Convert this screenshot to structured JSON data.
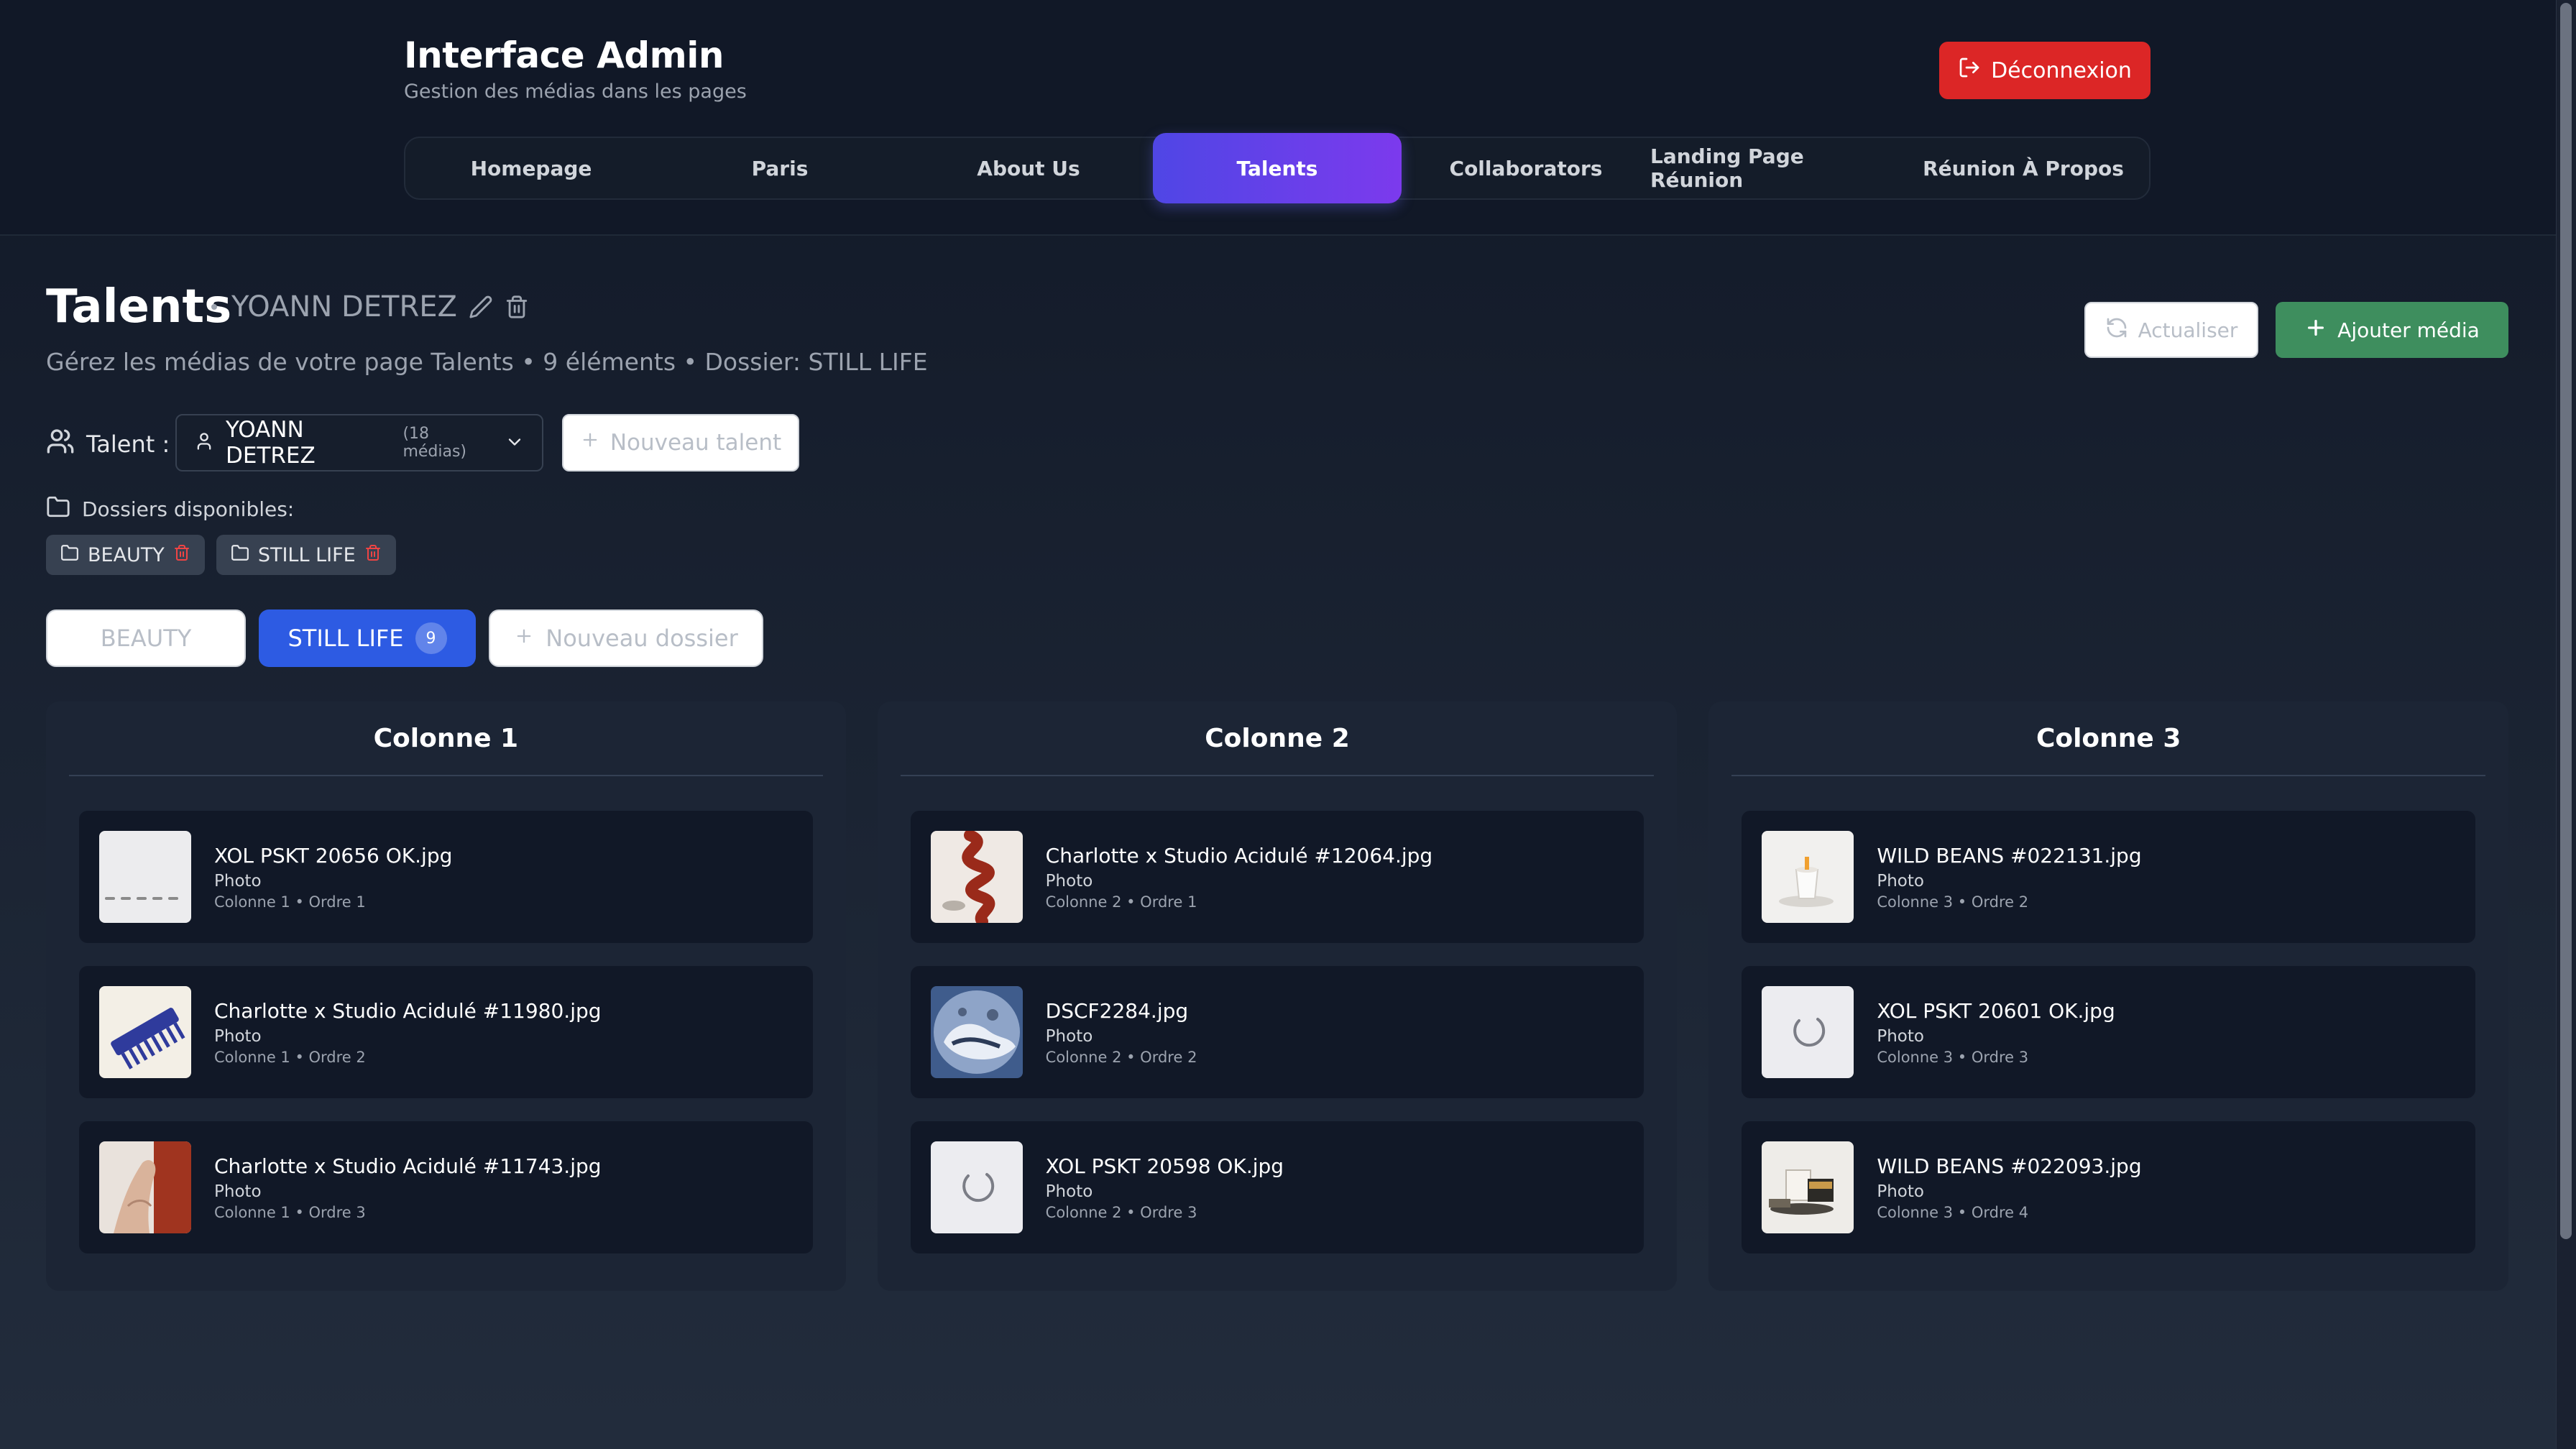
{
  "header": {
    "title": "Interface Admin",
    "subtitle": "Gestion des médias dans les pages",
    "logout_label": "Déconnexion",
    "nav": [
      "Homepage",
      "Paris",
      "About Us",
      "Talents",
      "Collaborators",
      "Landing Page Réunion",
      "Réunion À Propos"
    ],
    "active_nav": "Talents"
  },
  "page": {
    "title": "Talents",
    "talent_name": "YOANN DETREZ",
    "description": "Gérez les médias de votre page Talents • 9 éléments • Dossier: STILL LIFE",
    "refresh_label": "Actualiser",
    "add_label": "Ajouter média"
  },
  "talent_selector": {
    "label": "Talent :",
    "selected_name": "YOANN DETREZ",
    "selected_count": "(18 médias)",
    "new_talent_label": "Nouveau talent"
  },
  "folders": {
    "label": "Dossiers disponibles:",
    "chips": [
      "BEAUTY",
      "STILL LIFE"
    ],
    "tabs": [
      {
        "label": "BEAUTY",
        "active": false
      },
      {
        "label": "STILL LIFE",
        "active": true,
        "count": "9"
      }
    ],
    "new_folder_label": "Nouveau dossier"
  },
  "columns": [
    {
      "title": "Colonne 1",
      "items": [
        {
          "name": "XOL PSKT 20656 OK.jpg",
          "type": "Photo",
          "position": "Colonne 1 • Ordre 1",
          "thumb": "jewelry-row"
        },
        {
          "name": "Charlotte x Studio Acidulé #11980.jpg",
          "type": "Photo",
          "position": "Colonne 1 • Ordre 2",
          "thumb": "blue-comb"
        },
        {
          "name": "Charlotte x Studio Acidulé #11743.jpg",
          "type": "Photo",
          "position": "Colonne 1 • Ordre 3",
          "thumb": "hand-red"
        }
      ]
    },
    {
      "title": "Colonne 2",
      "items": [
        {
          "name": "Charlotte x Studio Acidulé #12064.jpg",
          "type": "Photo",
          "position": "Colonne 2 • Ordre 1",
          "thumb": "red-ribbon"
        },
        {
          "name": "DSCF2284.jpg",
          "type": "Photo",
          "position": "Colonne 2 • Ordre 2",
          "thumb": "silver-object"
        },
        {
          "name": "XOL PSKT 20598 OK.jpg",
          "type": "Photo",
          "position": "Colonne 2 • Ordre 3",
          "thumb": "ring"
        }
      ]
    },
    {
      "title": "Colonne 3",
      "items": [
        {
          "name": "WILD BEANS #022131.jpg",
          "type": "Photo",
          "position": "Colonne 3 • Ordre 2",
          "thumb": "cup"
        },
        {
          "name": "XOL PSKT 20601 OK.jpg",
          "type": "Photo",
          "position": "Colonne 3 • Ordre 3",
          "thumb": "ring"
        },
        {
          "name": "WILD BEANS #022093.jpg",
          "type": "Photo",
          "position": "Colonne 3 • Ordre 4",
          "thumb": "products"
        }
      ]
    }
  ],
  "colors": {
    "logout": "#dc2626",
    "nav_active_from": "#4f46e5",
    "nav_active_to": "#7c3aed",
    "add_media": "#3e8e5e",
    "folder_active": "#2d5be3"
  }
}
